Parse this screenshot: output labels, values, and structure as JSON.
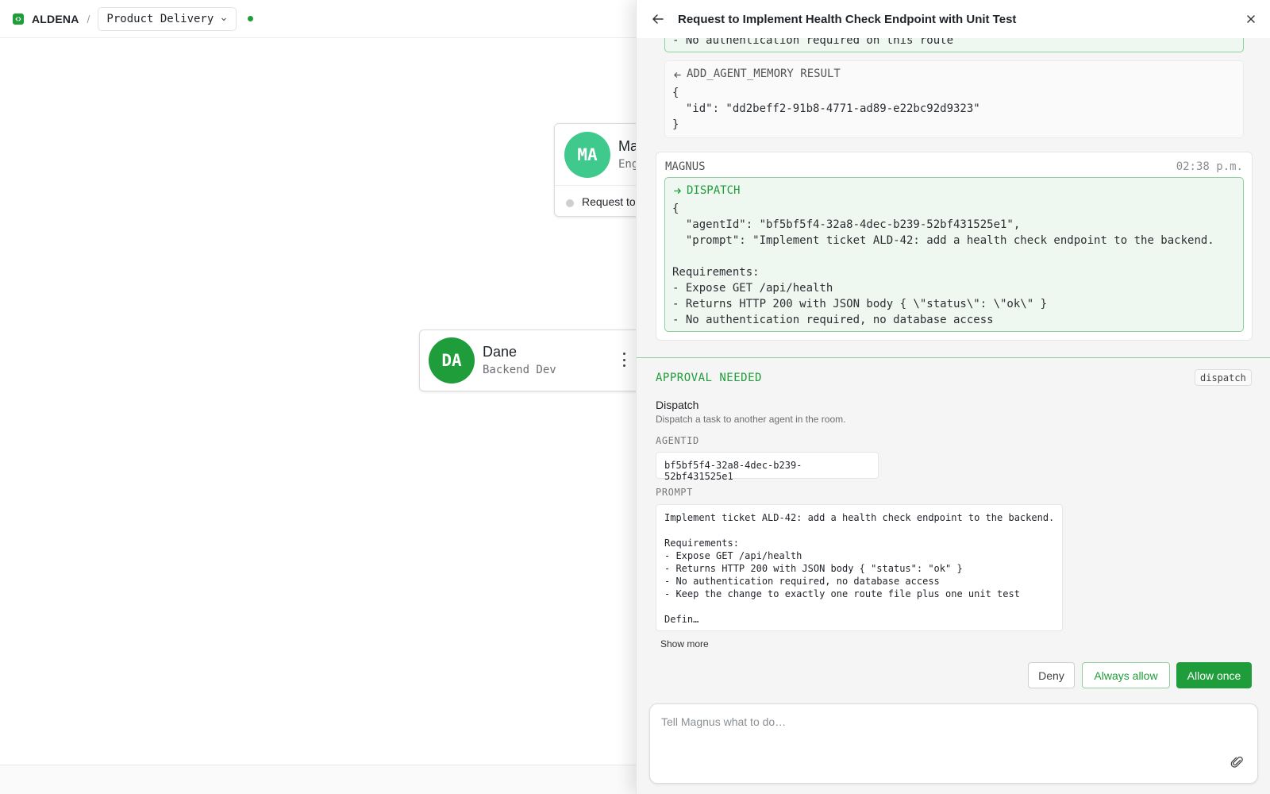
{
  "topbar": {
    "brand": "ALDENA",
    "separator": "/",
    "room": "Product Delivery"
  },
  "canvas": {
    "agents": [
      {
        "initials": "MA",
        "name": "Ma",
        "role": "Eng",
        "status_text": "Request to",
        "color": "#3fc98c"
      },
      {
        "initials": "DA",
        "name": "Dane",
        "role": "Backend Dev",
        "color": "#1f9d3a"
      }
    ]
  },
  "drawer": {
    "title": "Request to Implement Health Check Endpoint with Unit Test",
    "history": {
      "prev_tail": "- No authentication required on this route",
      "result": {
        "label": "ADD_AGENT_MEMORY RESULT",
        "lines": [
          "{",
          "  \"id\": \"dd2beff2-91b8-4771-ad89-e22bc92d9323\"",
          "}"
        ]
      },
      "message": {
        "author": "MAGNUS",
        "time": "02:38 p.m.",
        "tool_label": "DISPATCH",
        "lines": [
          "{",
          "  \"agentId\": \"bf5bf5f4-32a8-4dec-b239-52bf431525e1\",",
          "  \"prompt\": \"Implement ticket ALD-42: add a health check endpoint to the backend.",
          "",
          "Requirements:",
          "- Expose GET /api/health",
          "- Returns HTTP 200 with JSON body { \\\"status\\\": \\\"ok\\\" }",
          "- No authentication required, no database access"
        ]
      }
    },
    "approval": {
      "title": "APPROVAL NEEDED",
      "tag": "dispatch",
      "tool_name": "Dispatch",
      "tool_desc": "Dispatch a task to another agent in the room.",
      "agentid_label": "AGENTID",
      "agentid_value": "bf5bf5f4-32a8-4dec-b239-52bf431525e1",
      "prompt_label": "PROMPT",
      "prompt_lines": [
        "Implement ticket ALD-42: add a health check endpoint to the backend.",
        "",
        "Requirements:",
        "- Expose GET /api/health",
        "- Returns HTTP 200 with JSON body { \"status\": \"ok\" }",
        "- No authentication required, no database access",
        "- Keep the change to exactly one route file plus one unit test",
        "",
        "Defin…"
      ],
      "show_more": "Show more",
      "deny": "Deny",
      "always_allow": "Always allow",
      "allow_once": "Allow once"
    },
    "composer": {
      "placeholder": "Tell Magnus what to do…"
    }
  },
  "colors": {
    "accent": "#1f9d3a",
    "accent_light": "#3fc98c",
    "approval_border": "#8fcf9d"
  }
}
